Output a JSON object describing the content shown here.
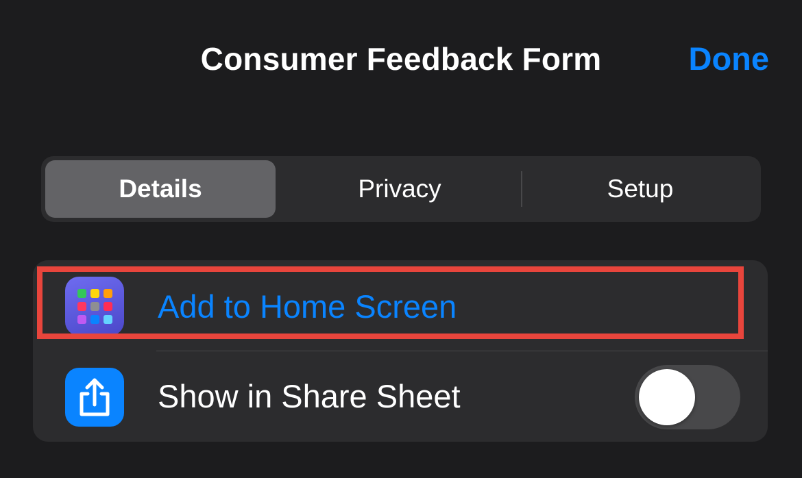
{
  "header": {
    "title": "Consumer Feedback Form",
    "done_label": "Done"
  },
  "segments": [
    {
      "label": "Details",
      "selected": true
    },
    {
      "label": "Privacy",
      "selected": false
    },
    {
      "label": "Setup",
      "selected": false
    }
  ],
  "rows": [
    {
      "label": "Add to Home Screen",
      "icon": "home-screen-grid-icon",
      "highlighted": true
    },
    {
      "label": "Show in Share Sheet",
      "icon": "share-icon",
      "toggle_on": false
    }
  ],
  "colors": {
    "accent": "#0a84ff",
    "background": "#1c1c1e",
    "card": "#2c2c2e",
    "highlight_border": "#e8453c",
    "home_icon_bg": "#5e5ce6",
    "share_icon_bg": "#0a84ff"
  }
}
